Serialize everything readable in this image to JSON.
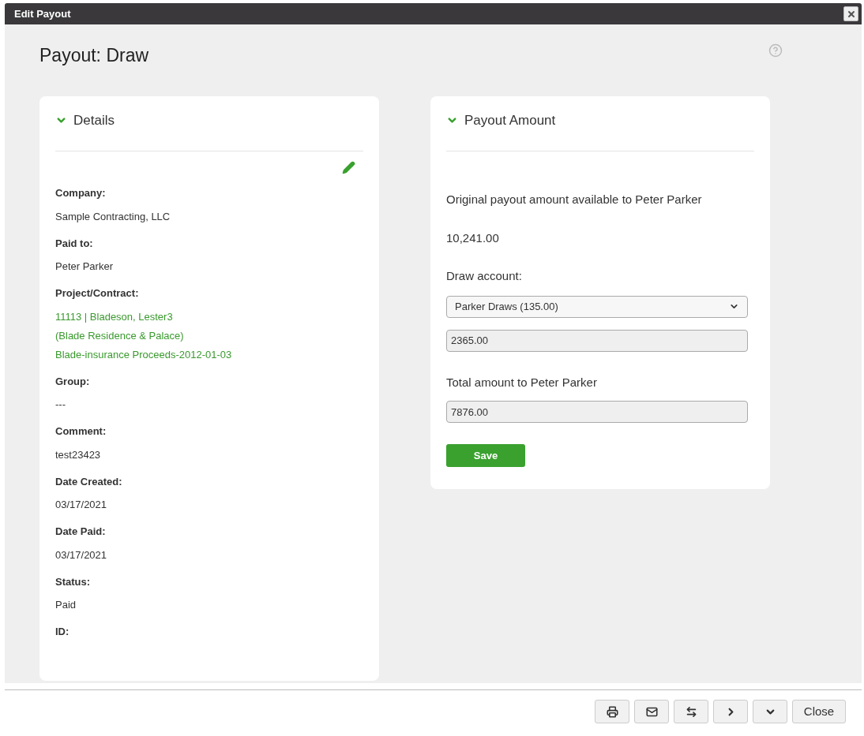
{
  "dialog": {
    "title": "Edit Payout"
  },
  "page_title": "Payout: Draw",
  "details": {
    "heading": "Details",
    "expanded": true,
    "fields": [
      {
        "label": "Company:",
        "values": [
          {
            "text": "Sample Contracting, LLC",
            "kind": "plain"
          }
        ]
      },
      {
        "label": "Paid to:",
        "values": [
          {
            "text": "Peter Parker",
            "kind": "plain"
          }
        ]
      },
      {
        "label": "Project/Contract:",
        "values": [
          {
            "text": "11113 | Bladeson, Lester3",
            "kind": "link"
          },
          {
            "text": "(Blade Residence & Palace)",
            "kind": "link"
          },
          {
            "text": "Blade-insurance Proceeds-2012-01-03",
            "kind": "link"
          }
        ]
      },
      {
        "label": "Group:",
        "values": [
          {
            "text": "---",
            "kind": "plain"
          }
        ]
      },
      {
        "label": "Comment:",
        "values": [
          {
            "text": "test23423",
            "kind": "plain"
          }
        ]
      },
      {
        "label": "Date Created:",
        "values": [
          {
            "text": "03/17/2021",
            "kind": "plain"
          }
        ]
      },
      {
        "label": "Date Paid:",
        "values": [
          {
            "text": "03/17/2021",
            "kind": "plain"
          }
        ]
      },
      {
        "label": "Status:",
        "values": [
          {
            "text": "Paid",
            "kind": "plain"
          }
        ]
      },
      {
        "label": "ID:"
      }
    ]
  },
  "payout_amount": {
    "heading": "Payout Amount",
    "expanded": true,
    "original_label": "Original payout amount available to Peter Parker",
    "original_value": "10,241.00",
    "draw_account_label": "Draw account:",
    "draw_account_select": "Parker Draws (135.00)",
    "draw_amount": "2365.00",
    "total_label": "Total amount to Peter Parker",
    "total_value": "7876.00",
    "save_button": "Save"
  },
  "footer": {
    "close_button": "Close"
  }
}
